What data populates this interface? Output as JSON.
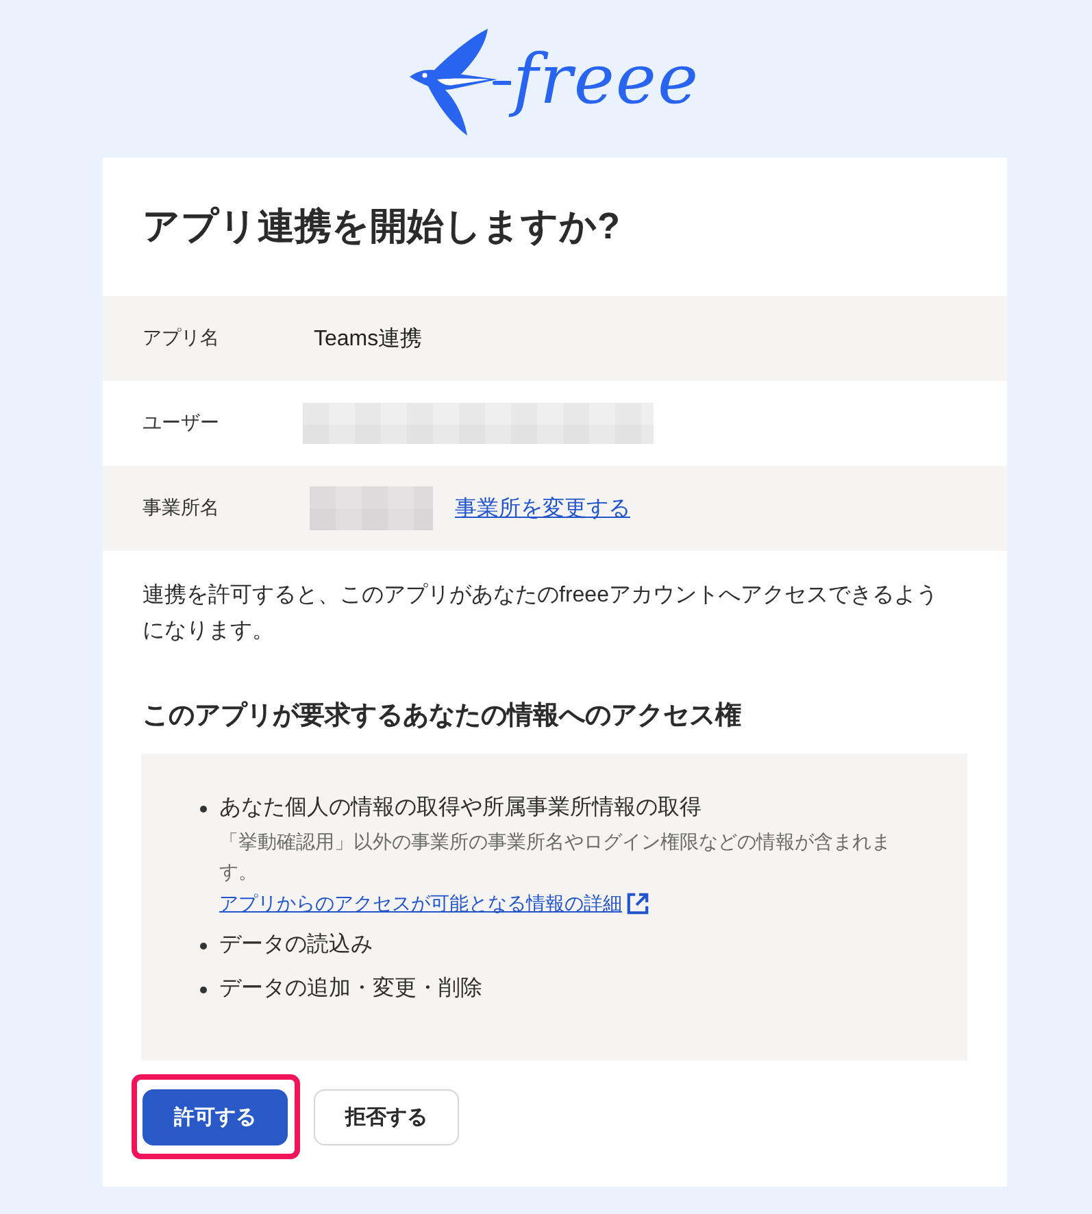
{
  "logo": {
    "wordmark": "freee"
  },
  "title": "アプリ連携を開始しますか?",
  "details": [
    {
      "label": "アプリ名",
      "kind": "text",
      "value": "Teams連携"
    },
    {
      "label": "ユーザー",
      "kind": "masked"
    },
    {
      "label": "事業所名",
      "kind": "masked",
      "link": "事業所を変更する"
    }
  ],
  "description": "連携を許可すると、このアプリがあなたのfreeeアカウントへアクセスできるようになります。",
  "access": {
    "heading": "このアプリが要求するあなたの情報へのアクセス権",
    "items": [
      {
        "text": "あなた個人の情報の取得や所属事業所情報の取得",
        "note": "「挙動確認用」以外の事業所の事業所名やログイン権限などの情報が含まれます。",
        "link": "アプリからのアクセスが可能となる情報の詳細"
      },
      {
        "text": "データの読込み"
      },
      {
        "text": "データの追加・変更・削除"
      }
    ]
  },
  "buttons": [
    {
      "label": "許可する",
      "kind": "primary",
      "highlighted": true
    },
    {
      "label": "拒否する",
      "kind": "secondary",
      "highlighted": false
    }
  ]
}
